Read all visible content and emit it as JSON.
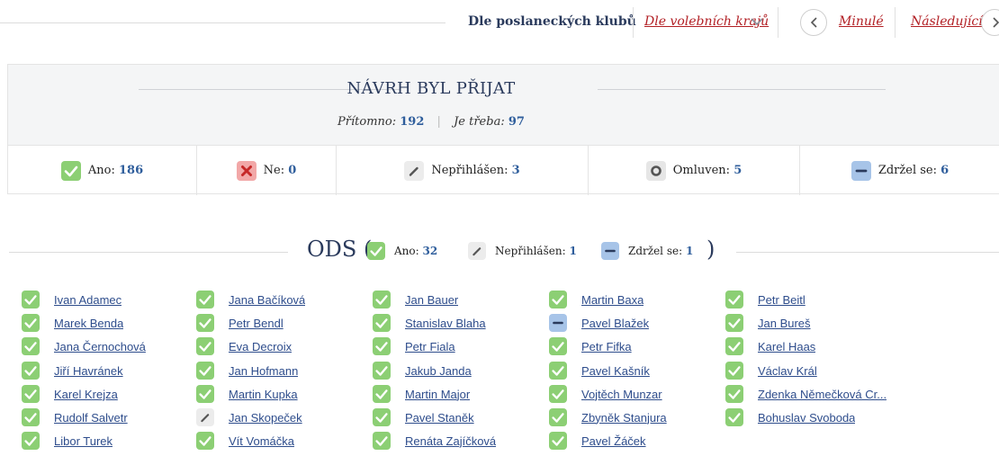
{
  "nav": {
    "by_club": "Dle poslaneckých klubů",
    "by_region": "Dle volebních krajů",
    "previous": "Minulé",
    "next": "Následující"
  },
  "result": {
    "title": "NÁVRH BYL PŘIJAT",
    "present_label": "Přítomno:",
    "present_value": "192",
    "required_label": "Je třeba:",
    "required_value": "97"
  },
  "stats": [
    {
      "icon": "check-icon",
      "label": "Ano:",
      "value": "186"
    },
    {
      "icon": "cross-icon",
      "label": "Ne:",
      "value": "0"
    },
    {
      "icon": "pencil-icon",
      "label": "Nepřihlášen:",
      "value": "3"
    },
    {
      "icon": "dot-icon",
      "label": "Omluven:",
      "value": "5"
    },
    {
      "icon": "minus-icon",
      "label": "Zdržel se:",
      "value": "6"
    }
  ],
  "party": {
    "name": "ODS (",
    "close": ")",
    "stats": [
      {
        "icon": "check-icon",
        "label": "Ano:",
        "value": "32"
      },
      {
        "icon": "pencil-icon",
        "label": "Nepřihlášen:",
        "value": "1"
      },
      {
        "icon": "minus-icon",
        "label": "Zdržel se:",
        "value": "1"
      }
    ]
  },
  "members": [
    {
      "name": "Ivan Adamec",
      "vote": "ano"
    },
    {
      "name": "Jana Bačíková",
      "vote": "ano"
    },
    {
      "name": "Jan Bauer",
      "vote": "ano"
    },
    {
      "name": "Martin Baxa",
      "vote": "ano"
    },
    {
      "name": "Petr Beitl",
      "vote": "ano"
    },
    {
      "name": "Marek Benda",
      "vote": "ano"
    },
    {
      "name": "Petr Bendl",
      "vote": "ano"
    },
    {
      "name": "Stanislav Blaha",
      "vote": "ano"
    },
    {
      "name": "Pavel Blažek",
      "vote": "zdrzel"
    },
    {
      "name": "Jan Bureš",
      "vote": "ano"
    },
    {
      "name": "Jana Černochová",
      "vote": "ano"
    },
    {
      "name": "Eva Decroix",
      "vote": "ano"
    },
    {
      "name": "Petr Fiala",
      "vote": "ano"
    },
    {
      "name": "Petr Fifka",
      "vote": "ano"
    },
    {
      "name": "Karel Haas",
      "vote": "ano"
    },
    {
      "name": "Jiří Havránek",
      "vote": "ano"
    },
    {
      "name": "Jan Hofmann",
      "vote": "ano"
    },
    {
      "name": "Jakub Janda",
      "vote": "ano"
    },
    {
      "name": "Pavel Kašník",
      "vote": "ano"
    },
    {
      "name": "Václav Král",
      "vote": "ano"
    },
    {
      "name": "Karel Krejza",
      "vote": "ano"
    },
    {
      "name": "Martin Kupka",
      "vote": "ano"
    },
    {
      "name": "Martin Major",
      "vote": "ano"
    },
    {
      "name": "Vojtěch Munzar",
      "vote": "ano"
    },
    {
      "name": "Zdenka Němečková Cr...",
      "vote": "ano"
    },
    {
      "name": "Rudolf Salvetr",
      "vote": "ano"
    },
    {
      "name": "Jan Skopeček",
      "vote": "neprihlasen"
    },
    {
      "name": "Pavel Staněk",
      "vote": "ano"
    },
    {
      "name": "Zbyněk Stanjura",
      "vote": "ano"
    },
    {
      "name": "Bohuslav Svoboda",
      "vote": "ano"
    },
    {
      "name": "Libor Turek",
      "vote": "ano"
    },
    {
      "name": "Vít Vomáčka",
      "vote": "ano"
    },
    {
      "name": "Renáta Zajíčková",
      "vote": "ano"
    },
    {
      "name": "Pavel Žáček",
      "vote": "ano"
    }
  ]
}
